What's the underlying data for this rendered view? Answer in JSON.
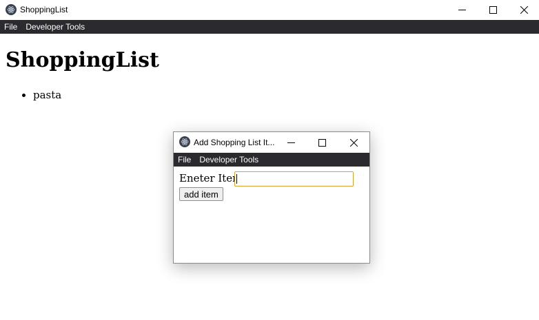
{
  "window": {
    "title": "ShoppingList",
    "controls": {
      "minimize": "minimize-icon",
      "maximize": "maximize-icon",
      "close": "close-icon"
    }
  },
  "menu": {
    "items": [
      {
        "label": "File"
      },
      {
        "label": "Developer Tools"
      }
    ]
  },
  "main": {
    "heading": "ShoppingList",
    "items": [
      "pasta"
    ]
  },
  "dialog": {
    "title": "Add Shopping List It...",
    "menu": [
      {
        "label": "File"
      },
      {
        "label": "Developer Tools"
      }
    ],
    "field_label": "Eneter Item",
    "field_value": "",
    "button_label": "add item",
    "accent_color": "#d7a22d"
  },
  "colors": {
    "menubar_bg": "#2b2b2f",
    "menubar_text": "#ffffff"
  }
}
